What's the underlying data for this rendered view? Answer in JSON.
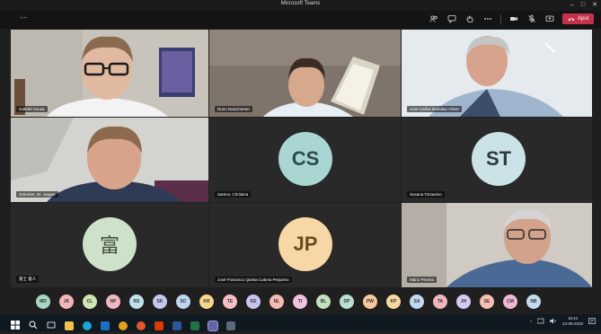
{
  "window": {
    "title": "Microsoft Teams",
    "minimize": "–",
    "maximize": "□",
    "close": "✕"
  },
  "meeting": {
    "timer": "–:–"
  },
  "toolbar": {
    "leave_label": "Apul"
  },
  "tiles": [
    {
      "name": "Gabriel Sousa",
      "type": "video",
      "bg": "#b8b4ad"
    },
    {
      "name": "Nuno Nascimento",
      "type": "video",
      "bg": "#8b8178"
    },
    {
      "name": "Jose Carlos Brandao Oliver",
      "type": "video",
      "bg": "#d9dfe4"
    },
    {
      "name": "Grimmer, Dr. Jurgen",
      "type": "video",
      "bg": "#cfcfca"
    },
    {
      "name": "Santos, Christina",
      "type": "avatar",
      "initials": "CS",
      "bg": "#a9d6d3",
      "fg": "#2c4a4a"
    },
    {
      "name": "Susana Tomasino",
      "type": "avatar",
      "initials": "ST",
      "bg": "#cbe3e6",
      "fg": "#2e3a40"
    },
    {
      "name": "富士 富人",
      "type": "avatar",
      "initials": "富",
      "bg": "#cde2c9",
      "fg": "#3d4e3a"
    },
    {
      "name": "José Francisco Quinta Cabeia Pequeno",
      "type": "avatar",
      "initials": "JP",
      "bg": "#f7d7a6",
      "fg": "#6b4a1f"
    },
    {
      "name": "Mário Pereira",
      "type": "video",
      "bg": "#c7c1b8"
    }
  ],
  "roster": [
    {
      "initials": "MD",
      "color": "#a8d6c3"
    },
    {
      "initials": "JK",
      "color": "#f3b6b8"
    },
    {
      "initials": "CL",
      "color": "#cfe6b3"
    },
    {
      "initials": "NP",
      "color": "#f2b7c4"
    },
    {
      "initials": "RS",
      "color": "#bfe2ec"
    },
    {
      "initials": "SK",
      "color": "#c6c7ef"
    },
    {
      "initials": "SC",
      "color": "#bcd7ef"
    },
    {
      "initials": "KR",
      "color": "#f7d58a"
    },
    {
      "initials": "TE",
      "color": "#f4bfc7"
    },
    {
      "initials": "KE",
      "color": "#c9c4ef"
    },
    {
      "initials": "NL",
      "color": "#f6b9b4"
    },
    {
      "initials": "TI",
      "color": "#f0c2de"
    },
    {
      "initials": "BL",
      "color": "#c3e1c0"
    },
    {
      "initials": "DP",
      "color": "#b9e0d4"
    },
    {
      "initials": "PW",
      "color": "#f6c79b"
    },
    {
      "initials": "KP",
      "color": "#f8d9a2"
    },
    {
      "initials": "SA",
      "color": "#c1d9f0"
    },
    {
      "initials": "TA",
      "color": "#f1b4bc"
    },
    {
      "initials": "JH",
      "color": "#d3c9f1"
    },
    {
      "initials": "SE",
      "color": "#f7c0b2"
    },
    {
      "initials": "CM",
      "color": "#f0b7d2"
    },
    {
      "initials": "NB",
      "color": "#c2dcef"
    }
  ],
  "taskbar": {
    "time": "18:42",
    "date": "22-09-2020"
  }
}
